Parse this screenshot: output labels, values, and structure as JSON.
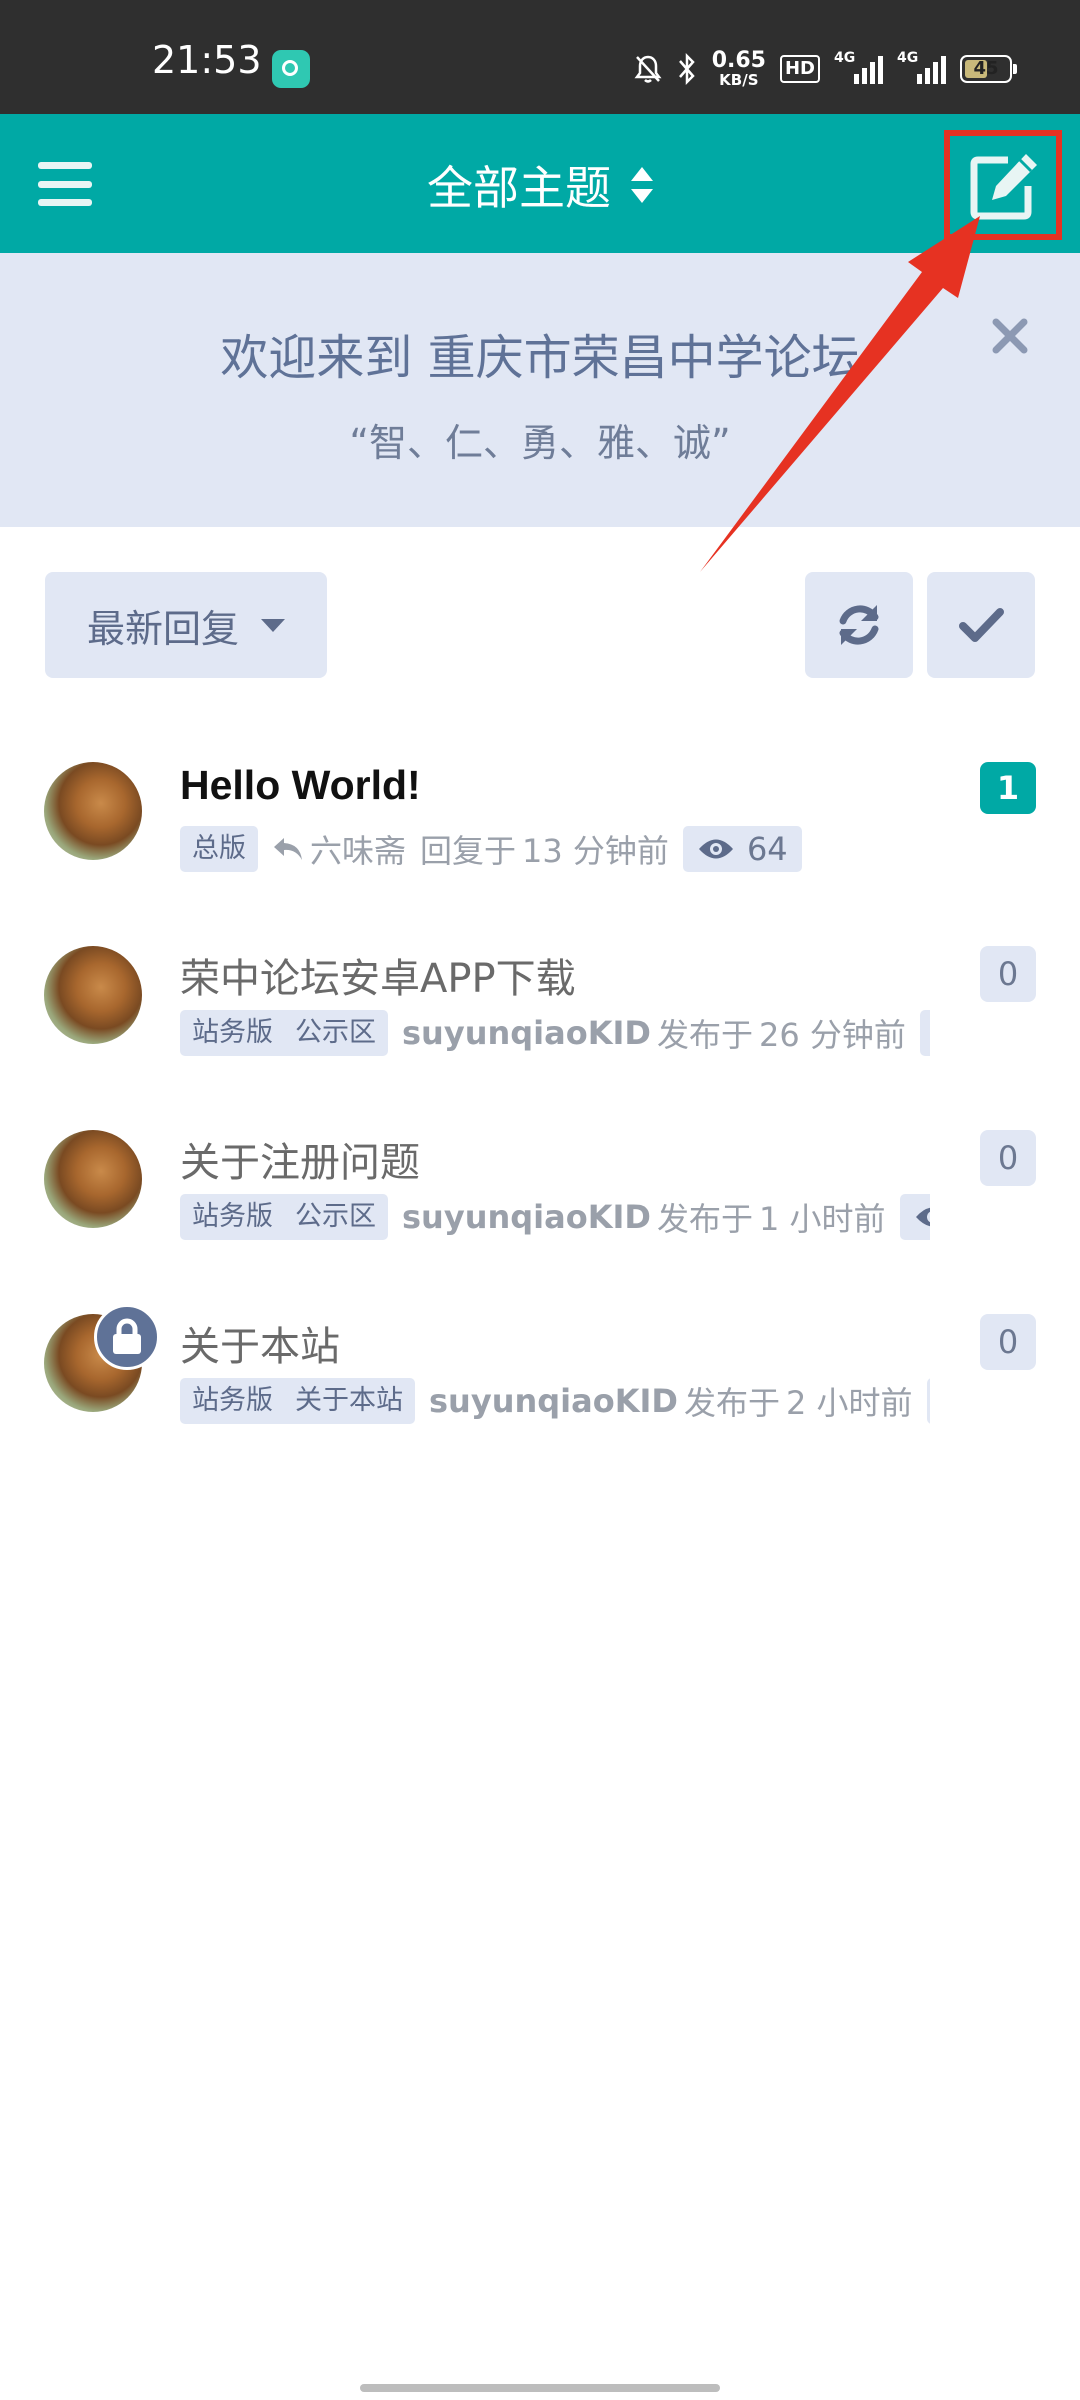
{
  "status_bar": {
    "time": "21:53",
    "net_speed_value": "0.65",
    "net_speed_unit": "KB/S",
    "hd_label": "HD",
    "sim1": "4G",
    "sim2": "4G",
    "battery": "45"
  },
  "header": {
    "title": "全部主题",
    "menu_icon": "hamburger-menu-icon",
    "compose_icon": "edit-icon"
  },
  "hero": {
    "title": "欢迎来到 重庆市荣昌中学论坛",
    "subtitle": "“智、仁、勇、雅、诚”",
    "close_icon": "close-icon"
  },
  "toolbar": {
    "sort_label": "最新回复",
    "refresh_icon": "refresh-icon",
    "mark_read_icon": "check-icon"
  },
  "discussions": [
    {
      "title": "Hello World!",
      "tags": [
        "总版"
      ],
      "user": "六味斋",
      "action": "回复于",
      "time": "13 分钟前",
      "views": "64",
      "count": "1"
    },
    {
      "title": "荣中论坛安卓APP下载",
      "tags": [
        "站务版",
        "公示区"
      ],
      "user": "suyunqiaoKID",
      "action": "发布于",
      "time": "26 分钟前",
      "count": "0"
    },
    {
      "title": "关于注册问题",
      "tags": [
        "站务版",
        "公示区"
      ],
      "user": "suyunqiaoKID",
      "action": "发布于",
      "time": "1 小时前",
      "count": "0"
    },
    {
      "title": "关于本站",
      "tags": [
        "站务版",
        "关于本站"
      ],
      "user": "suyunqiaoKID",
      "action": "发布于",
      "time": "2 小时前",
      "count": "0",
      "locked": true
    }
  ],
  "colors": {
    "accent": "#00a9a5",
    "annotation_red": "#e63222",
    "tag_bg": "#e1e7f4",
    "muted_text": "#5d6b8a"
  }
}
